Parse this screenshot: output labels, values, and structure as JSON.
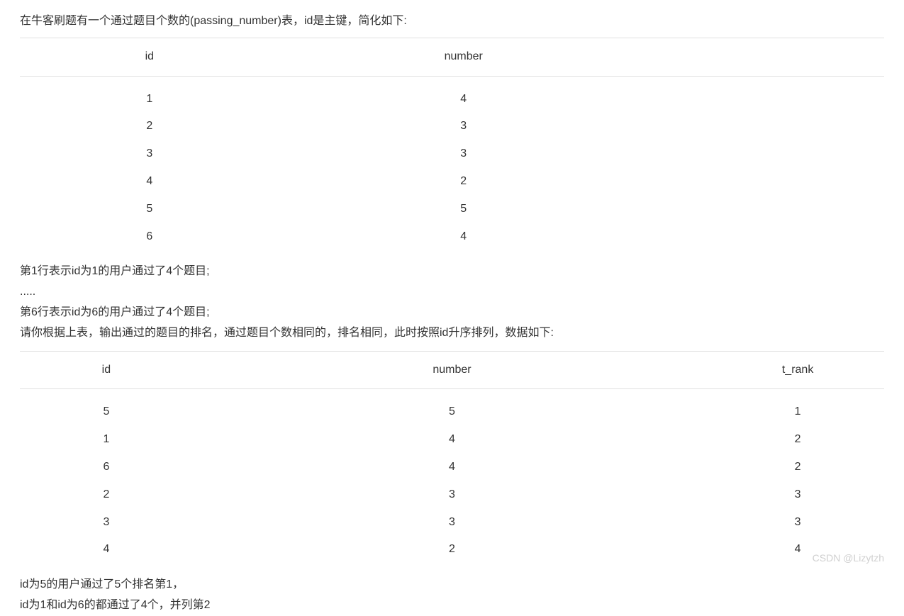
{
  "intro": "在牛客刷题有一个通过题目个数的(passing_number)表，id是主键，简化如下:",
  "table1": {
    "headers": [
      "id",
      "number"
    ],
    "rows": [
      {
        "id": "1",
        "number": "4"
      },
      {
        "id": "2",
        "number": "3"
      },
      {
        "id": "3",
        "number": "3"
      },
      {
        "id": "4",
        "number": "2"
      },
      {
        "id": "5",
        "number": "5"
      },
      {
        "id": "6",
        "number": "4"
      }
    ]
  },
  "desc": {
    "line1": "第1行表示id为1的用户通过了4个题目;",
    "line2": ".....",
    "line3": "第6行表示id为6的用户通过了4个题目;",
    "line4": "请你根据上表，输出通过的题目的排名，通过题目个数相同的，排名相同，此时按照id升序排列，数据如下:"
  },
  "table2": {
    "headers": [
      "id",
      "number",
      "t_rank"
    ],
    "rows": [
      {
        "id": "5",
        "number": "5",
        "t_rank": "1"
      },
      {
        "id": "1",
        "number": "4",
        "t_rank": "2"
      },
      {
        "id": "6",
        "number": "4",
        "t_rank": "2"
      },
      {
        "id": "2",
        "number": "3",
        "t_rank": "3"
      },
      {
        "id": "3",
        "number": "3",
        "t_rank": "3"
      },
      {
        "id": "4",
        "number": "2",
        "t_rank": "4"
      }
    ]
  },
  "footer": {
    "line1": "id为5的用户通过了5个排名第1，",
    "line2": "id为1和id为6的都通过了4个，并列第2"
  },
  "watermark": "CSDN @Lizytzh"
}
